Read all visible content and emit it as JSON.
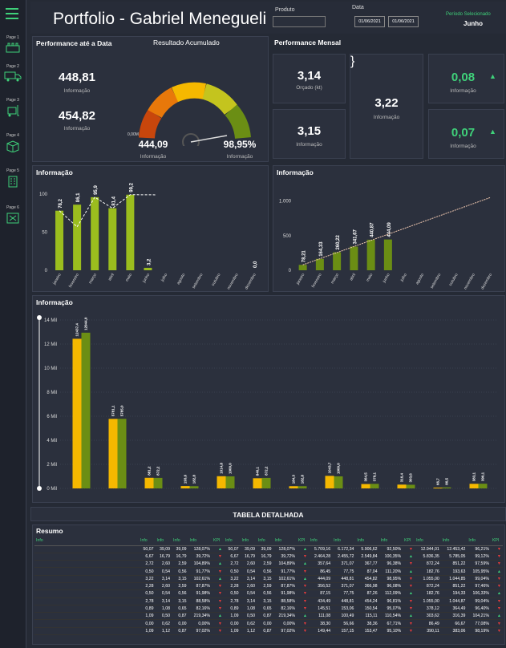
{
  "header": {
    "title": "Portfolio - Gabriel Menegueli",
    "produto_label": "Produto",
    "data_label": "Data",
    "date_start": "01/06/2021",
    "date_end": "01/06/2021",
    "periodo_label": "Período Selecionado",
    "periodo_value": "Junho"
  },
  "sidebar": {
    "pages": [
      "Page 1",
      "Page 2",
      "Page 3",
      "Page 4",
      "Page 5",
      "Page 6"
    ]
  },
  "perf_data": {
    "title": "Performance até a Data",
    "gauge_title": "Resultado Acumulado",
    "v1": "448,81",
    "l1": "Informação",
    "v2": "454,82",
    "l2": "Informação",
    "g_min": "0,00M",
    "g_left": "444,09",
    "g_left_lbl": "Informação",
    "g_right": "98,95%",
    "g_right_lbl": "Informação"
  },
  "perf_mensal": {
    "title": "Performance Mensal",
    "c1": "3,14",
    "c1l": "Orçado (kt)",
    "c2": "3,15",
    "c2l": "Informação",
    "c3": "3,22",
    "c3l": "Informação",
    "c4": "0,08",
    "c4l": "Informação",
    "c5": "0,07",
    "c5l": "Informação"
  },
  "chart_titles": {
    "left": "Informação",
    "right": "Informação",
    "bottom": "Informação",
    "table": "TABELA DETALHADA",
    "resumo": "Resumo"
  },
  "chart_data": [
    {
      "type": "bar",
      "title": "Informação",
      "categories": [
        "janeiro",
        "fevereiro",
        "março",
        "abril",
        "maio",
        "junho",
        "julho",
        "agosto",
        "setembro",
        "outubro",
        "novembro",
        "dezembro"
      ],
      "values": [
        78.2,
        86.1,
        95.9,
        81.4,
        99.2,
        3.2,
        null,
        null,
        null,
        null,
        null,
        0.0
      ],
      "labels": [
        "78,2",
        "86,1",
        "95,9",
        "81,4",
        "99,2",
        "3,2",
        "",
        "",
        "",
        "",
        "",
        "0,0"
      ],
      "yticks": [
        "100",
        "50",
        "0"
      ],
      "ylim": [
        0,
        100
      ],
      "line_values": [
        78.2,
        57,
        95.9,
        81.4,
        99.2
      ]
    },
    {
      "type": "bar",
      "title": "Informação",
      "categories": [
        "janeiro",
        "fevereiro",
        "março",
        "abril",
        "maio",
        "junho",
        "julho",
        "agosto",
        "setembro",
        "outubro",
        "novembro",
        "dezembro"
      ],
      "values": [
        78.21,
        164.33,
        260.22,
        341.67,
        440.87,
        444.09,
        null,
        null,
        null,
        null,
        null,
        null
      ],
      "labels": [
        "78,21",
        "164,33",
        "260,22",
        "341,67",
        "440,87",
        "444,09",
        "",
        "",
        "",
        "",
        "",
        ""
      ],
      "yticks": [
        "1.000",
        "500",
        "0"
      ],
      "ylim": [
        0,
        1100
      ],
      "trend_end": 1050
    },
    {
      "type": "bar",
      "title": "Informação",
      "groups": 12,
      "series": [
        {
          "values": [
            12437.4,
            5781.1,
            881.2,
            193.6,
            1014.8,
            846.1,
            184.3,
            1043.7,
            364.5,
            316.4,
            66.7,
            383.1
          ]
        },
        {
          "values": [
            12944.0,
            5785.0,
            872.2,
            182.8,
            1000.0,
            872.2,
            182.8,
            1000.0,
            379.1,
            303.6,
            86.5,
            390.1
          ]
        }
      ],
      "labels_a": [
        "12437,4",
        "5781,1",
        "881,2",
        "193,6",
        "1014,8",
        "846,1",
        "184,3",
        "1043,7",
        "364,5",
        "316,4",
        "66,7",
        "383,1"
      ],
      "labels_b": [
        "12944,0",
        "5785,0",
        "872,2",
        "182,8",
        "1000,0",
        "872,2",
        "182,8",
        "1000,0",
        "379,1",
        "303,6",
        "86,5",
        "390,1"
      ],
      "yticks": [
        "14 Mil",
        "12 Mil",
        "10 Mil",
        "8 Mil",
        "6 Mil",
        "4 Mil",
        "2 Mil",
        "0 Mil"
      ],
      "ylim": [
        0,
        14000
      ]
    }
  ],
  "table": {
    "headers": [
      "Info",
      "Info",
      "Info",
      "Info",
      "Info",
      "KPI",
      "Info",
      "Info",
      "Info",
      "Info",
      "KPI",
      "Info",
      "Info",
      "Info",
      "Info",
      "KPI",
      "Info",
      "Info",
      "Info",
      "KPI"
    ],
    "rows": [
      [
        "",
        "50,07",
        "39,09",
        "39,09",
        "128,07%",
        "▲",
        "50,07",
        "39,09",
        "39,09",
        "128,07%",
        "▲",
        "5.709,16",
        "6.172,34",
        "5.906,62",
        "92,50%",
        "▼",
        "12.944,01",
        "12.453,42",
        "96,21%",
        "▼"
      ],
      [
        "",
        "6,67",
        "16,79",
        "16,79",
        "39,72%",
        "▼",
        "6,67",
        "16,79",
        "16,79",
        "39,72%",
        "▼",
        "2.464,28",
        "2.455,72",
        "2.549,84",
        "100,35%",
        "▲",
        "5.836,35",
        "5.785,05",
        "99,12%",
        "▼"
      ],
      [
        "",
        "2,72",
        "2,60",
        "2,59",
        "104,89%",
        "▲",
        "2,72",
        "2,60",
        "2,59",
        "104,89%",
        "▲",
        "357,64",
        "371,07",
        "367,77",
        "96,38%",
        "▼",
        "872,24",
        "851,22",
        "97,59%",
        "▼"
      ],
      [
        "",
        "0,50",
        "0,54",
        "0,56",
        "91,77%",
        "▼",
        "0,50",
        "0,54",
        "0,56",
        "91,77%",
        "▼",
        "86,45",
        "77,75",
        "87,04",
        "111,20%",
        "▲",
        "182,76",
        "193,63",
        "105,95%",
        "▲"
      ],
      [
        "",
        "3,22",
        "3,14",
        "3,15",
        "102,61%",
        "▲",
        "3,22",
        "3,14",
        "3,15",
        "102,61%",
        "▲",
        "444,09",
        "448,81",
        "454,82",
        "98,95%",
        "▼",
        "1.055,00",
        "1.044,85",
        "99,04%",
        "▼"
      ],
      [
        "",
        "2,28",
        "2,60",
        "2,59",
        "87,87%",
        "▼",
        "2,28",
        "2,60",
        "2,59",
        "87,87%",
        "▼",
        "356,52",
        "371,07",
        "366,98",
        "96,08%",
        "▼",
        "872,24",
        "851,22",
        "97,46%",
        "▼"
      ],
      [
        "",
        "0,50",
        "0,54",
        "0,56",
        "91,98%",
        "▼",
        "0,50",
        "0,54",
        "0,56",
        "91,98%",
        "▼",
        "87,15",
        "77,75",
        "87,26",
        "112,09%",
        "▲",
        "182,76",
        "194,33",
        "106,33%",
        "▲"
      ],
      [
        "",
        "2,78",
        "3,14",
        "3,15",
        "88,58%",
        "▼",
        "2,78",
        "3,14",
        "3,15",
        "88,58%",
        "▼",
        "434,49",
        "448,81",
        "454,24",
        "96,81%",
        "▼",
        "1.055,00",
        "1.044,87",
        "99,04%",
        "▼"
      ],
      [
        "",
        "0,89",
        "1,08",
        "0,65",
        "82,16%",
        "▼",
        "0,89",
        "1,08",
        "0,65",
        "82,16%",
        "▼",
        "145,51",
        "153,06",
        "150,54",
        "95,07%",
        "▼",
        "378,12",
        "364,49",
        "96,40%",
        "▼"
      ],
      [
        "",
        "1,09",
        "0,50",
        "0,87",
        "219,34%",
        "▲",
        "1,09",
        "0,50",
        "0,87",
        "219,34%",
        "▲",
        "111,08",
        "100,49",
        "115,11",
        "110,54%",
        "▲",
        "303,62",
        "316,39",
        "104,21%",
        "▲"
      ],
      [
        "",
        "0,00",
        "0,62",
        "0,00",
        "0,00%",
        "▼",
        "0,00",
        "0,62",
        "0,00",
        "0,00%",
        "▼",
        "38,30",
        "56,66",
        "38,36",
        "67,71%",
        "▼",
        "86,49",
        "66,67",
        "77,08%",
        "▼"
      ],
      [
        "",
        "1,09",
        "1,12",
        "0,87",
        "97,02%",
        "▼",
        "1,09",
        "1,12",
        "0,87",
        "97,02%",
        "▼",
        "149,44",
        "157,15",
        "153,47",
        "95,10%",
        "▼",
        "390,11",
        "383,06",
        "98,19%",
        "▼"
      ]
    ]
  },
  "colors": {
    "accent": "#3fd17a",
    "green_bar": "#6b8e14",
    "yellow_bar": "#f5b800",
    "lime": "#9bbd1e"
  }
}
